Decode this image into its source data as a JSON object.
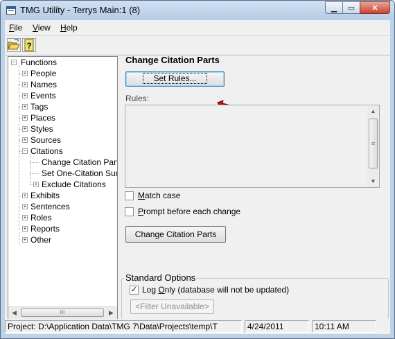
{
  "window": {
    "title": "TMG Utility - Terrys Main:1 (8)",
    "minimize": "▁",
    "maximize": "▭",
    "close": "✕"
  },
  "menu": [
    {
      "label": "File",
      "key": "F",
      "rest": "ile"
    },
    {
      "label": "View",
      "key": "V",
      "rest": "iew"
    },
    {
      "label": "Help",
      "key": "H",
      "rest": "elp"
    }
  ],
  "toolbar": {
    "items": [
      "open-folder-icon",
      "help-icon"
    ]
  },
  "tree": {
    "nodes": [
      {
        "label": "Functions",
        "expander": "−"
      },
      {
        "label": "People",
        "expander": "+"
      },
      {
        "label": "Names",
        "expander": "+"
      },
      {
        "label": "Events",
        "expander": "+"
      },
      {
        "label": "Tags",
        "expander": "+"
      },
      {
        "label": "Places",
        "expander": "+"
      },
      {
        "label": "Styles",
        "expander": "+"
      },
      {
        "label": "Sources",
        "expander": "+"
      },
      {
        "label": "Citations",
        "expander": "−"
      },
      {
        "label": "Change Citation Parts",
        "expander": ""
      },
      {
        "label": "Set One-Citation Surety",
        "expander": ""
      },
      {
        "label": "Exclude Citations",
        "expander": "+"
      },
      {
        "label": "Exhibits",
        "expander": "+"
      },
      {
        "label": "Sentences",
        "expander": "+"
      },
      {
        "label": "Roles",
        "expander": "+"
      },
      {
        "label": "Reports",
        "expander": "+"
      },
      {
        "label": "Other",
        "expander": "+"
      }
    ],
    "scroll_grip": "III"
  },
  "panel": {
    "title": "Change Citation Parts",
    "set_rules_label": "Set Rules...",
    "rules_label": "Rules:",
    "match_case": {
      "label": "Match case",
      "key": "M",
      "rest": "atch case",
      "checked": false
    },
    "prompt_each": {
      "label": "Prompt before each change",
      "key": "P",
      "rest": "rompt before each change",
      "checked": false
    },
    "run_button": "Change Citation Parts"
  },
  "standard_options": {
    "title": "Standard Options",
    "log_only": {
      "label": "Log Only (database will not be updated)",
      "pre": "Log ",
      "key": "O",
      "rest": "nly (database will not be updated)",
      "checked": true,
      "mark": "✓"
    },
    "filter_button": "<Filter Unavailable>"
  },
  "status": {
    "project": "Project: D:\\Application Data\\TMG 7\\Data\\Projects\\temp\\T",
    "date": "4/24/2011",
    "time": "10:11 AM"
  },
  "colors": {
    "title_bg": "#b9d1ea",
    "panel_bg": "#f0f0f0",
    "close_red": "#c9452f",
    "cursor_red": "#d01010"
  }
}
